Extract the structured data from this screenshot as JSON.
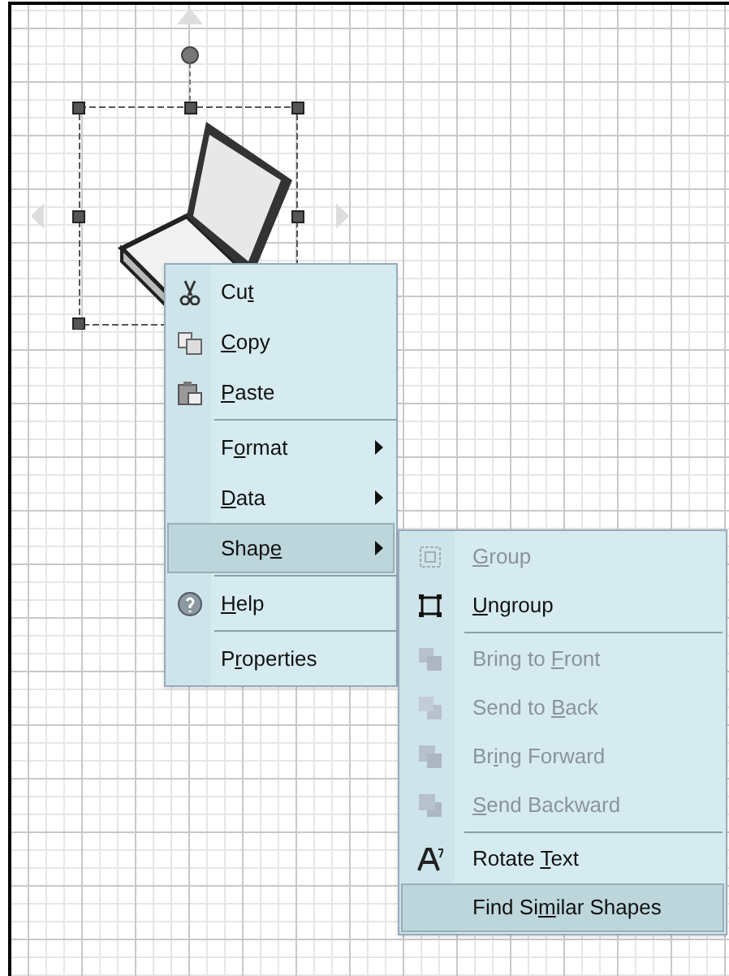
{
  "context_menu": {
    "items": [
      {
        "kind": "item",
        "text_before": "Cu",
        "access_key": "t",
        "submenu": false,
        "selected": false
      },
      {
        "kind": "item",
        "access_key": "C",
        "text_after": "opy",
        "submenu": false,
        "selected": false
      },
      {
        "kind": "item",
        "access_key": "P",
        "text_after": "aste",
        "submenu": false,
        "selected": false
      },
      {
        "kind": "separator"
      },
      {
        "kind": "item",
        "text_before": "F",
        "access_key": "o",
        "text_after": "rmat",
        "submenu": true,
        "selected": false
      },
      {
        "kind": "item",
        "access_key": "D",
        "text_after": "ata",
        "submenu": true,
        "selected": false
      },
      {
        "kind": "item",
        "text_before": "Shap",
        "access_key": "e",
        "submenu": true,
        "selected": true
      },
      {
        "kind": "separator"
      },
      {
        "kind": "item",
        "access_key": "H",
        "text_after": "elp",
        "submenu": false,
        "selected": false
      },
      {
        "kind": "separator"
      },
      {
        "kind": "item",
        "text_before": "P",
        "access_key": "r",
        "text_after": "operties",
        "submenu": false,
        "selected": false
      }
    ]
  },
  "shape_submenu": {
    "items": [
      {
        "kind": "item",
        "access_key": "G",
        "text_after": "roup",
        "selected": false,
        "disabled": true
      },
      {
        "kind": "item",
        "access_key": "U",
        "text_after": "ngroup",
        "selected": false,
        "disabled": false
      },
      {
        "kind": "separator"
      },
      {
        "kind": "item",
        "text_before": "Bring to ",
        "access_key": "F",
        "text_after": "ront",
        "selected": false,
        "disabled": true
      },
      {
        "kind": "item",
        "text_before": "Send to ",
        "access_key": "B",
        "text_after": "ack",
        "selected": false,
        "disabled": true
      },
      {
        "kind": "item",
        "text_before": "Br",
        "access_key": "i",
        "text_after": "ng Forward",
        "selected": false,
        "disabled": true
      },
      {
        "kind": "item",
        "access_key": "S",
        "text_after": "end Backward",
        "selected": false,
        "disabled": true
      },
      {
        "kind": "separator"
      },
      {
        "kind": "item",
        "text_before": "Rotate ",
        "access_key": "T",
        "text_after": "ext",
        "selected": false,
        "disabled": false
      },
      {
        "kind": "item",
        "text_before": "Find Si",
        "access_key": "m",
        "text_after": "ilar Shapes",
        "selected": true,
        "disabled": false
      }
    ]
  }
}
